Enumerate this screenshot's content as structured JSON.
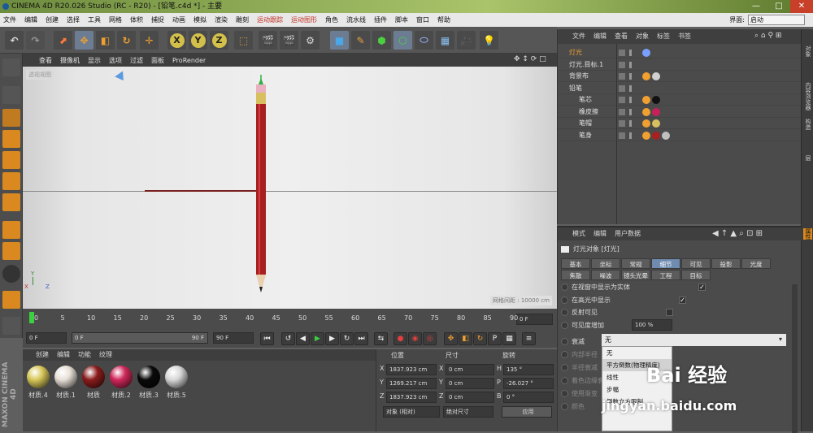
{
  "titlebar": {
    "title": "CINEMA 4D R20.026 Studio (RC - R20) - [铅笔.c4d *] - 主要"
  },
  "menu": [
    "文件",
    "编辑",
    "创建",
    "选择",
    "工具",
    "网格",
    "体积",
    "捕捉",
    "动画",
    "模拟",
    "渲染",
    "雕刻",
    "运动跟踪",
    "运动图形",
    "角色",
    "流水线",
    "插件",
    "脚本",
    "窗口",
    "帮助"
  ],
  "layout": {
    "label": "界面:",
    "value": "启动"
  },
  "toolbar": {
    "x": "X",
    "y": "Y",
    "z": "Z"
  },
  "viewport": {
    "menu": [
      "查看",
      "摄像机",
      "显示",
      "选项",
      "过滤",
      "面板",
      "ProRender"
    ],
    "label": "透视视图",
    "distance": "网格间距 : 10000 cm",
    "axis_y": "Y",
    "axis_x": "X",
    "axis_z": "Z"
  },
  "timeline": {
    "ticks": [
      "0",
      "5",
      "10",
      "15",
      "20",
      "25",
      "30",
      "35",
      "40",
      "45",
      "50",
      "55",
      "60",
      "65",
      "70",
      "75",
      "80",
      "85",
      "90"
    ],
    "end": "0 F"
  },
  "transport": {
    "start": "0 F",
    "range_start": "0 F",
    "range_end": "90 F",
    "end": "90 F"
  },
  "materials": {
    "tabs": [
      "创建",
      "编辑",
      "功能",
      "纹理"
    ],
    "items": [
      {
        "name": "材质.4",
        "color": "#d8c85a"
      },
      {
        "name": "材质.1",
        "color": "#e8e0d8"
      },
      {
        "name": "材质",
        "color": "#8b1c1c"
      },
      {
        "name": "材质.2",
        "color": "#d0285a"
      },
      {
        "name": "材质.3",
        "color": "#0a0a0a"
      },
      {
        "name": "材质.5",
        "color": "#d8d8d8"
      }
    ]
  },
  "coords": {
    "headers": [
      "位置",
      "尺寸",
      "旋转"
    ],
    "rows": [
      {
        "axis": "X",
        "pos": "1837.923 cm",
        "size_axis": "X",
        "size": "0 cm",
        "rot_axis": "H",
        "rot": "135 °"
      },
      {
        "axis": "Y",
        "pos": "1269.217 cm",
        "size_axis": "Y",
        "size": "0 cm",
        "rot_axis": "P",
        "rot": "-26.027 °"
      },
      {
        "axis": "Z",
        "pos": "1837.923 cm",
        "size_axis": "Z",
        "size": "0 cm",
        "rot_axis": "B",
        "rot": "0 °"
      }
    ],
    "mode": "对象 (相对)",
    "size_mode": "绝对尺寸",
    "apply": "应用"
  },
  "objects": {
    "tabs": [
      "文件",
      "编辑",
      "查看",
      "对象",
      "标签",
      "书签"
    ],
    "rows": [
      {
        "name": "灯光",
        "indent": 0,
        "selected": true
      },
      {
        "name": "灯光.目标.1",
        "indent": 0,
        "selected": false
      },
      {
        "name": "背景布",
        "indent": 0,
        "selected": false
      },
      {
        "name": "铅笔",
        "indent": 0,
        "selected": false
      },
      {
        "name": "笔芯",
        "indent": 1,
        "selected": false
      },
      {
        "name": "橡皮擦",
        "indent": 1,
        "selected": false
      },
      {
        "name": "笔帽",
        "indent": 1,
        "selected": false
      },
      {
        "name": "笔身",
        "indent": 1,
        "selected": false
      }
    ]
  },
  "side_tabs": [
    "对象",
    "内容浏览器",
    "构造",
    "层"
  ],
  "side_tab_bottom": "属性",
  "attributes": {
    "tabs": [
      "模式",
      "编辑",
      "用户数据"
    ],
    "title": "灯光对象 [灯光]",
    "tabs_row1": [
      "基本",
      "坐标",
      "常规",
      "细节",
      "可见",
      "投影",
      "光度"
    ],
    "tabs_row2": [
      "焦散",
      "噪波",
      "镜头光晕",
      "工程",
      "目标"
    ],
    "props": [
      {
        "label": "在视窗中显示为实体"
      },
      {
        "label": "在高光中显示"
      },
      {
        "label": "反射可见"
      },
      {
        "label": "可见度增加",
        "value": "100 %"
      },
      {
        "label": "衰减"
      },
      {
        "label": "内部半径"
      },
      {
        "label": "半径衰减"
      },
      {
        "label": "着色边缘衰减"
      },
      {
        "label": "使用渐变"
      },
      {
        "label": "颜色"
      }
    ],
    "falloff_value": "无",
    "falloff_options": [
      "无",
      "平方倒数(物理精度)",
      "线性",
      "步幅",
      "倒数立方限制"
    ]
  },
  "watermark": {
    "brand": "Bai 经验",
    "url": "jingyan.baidu.com"
  }
}
